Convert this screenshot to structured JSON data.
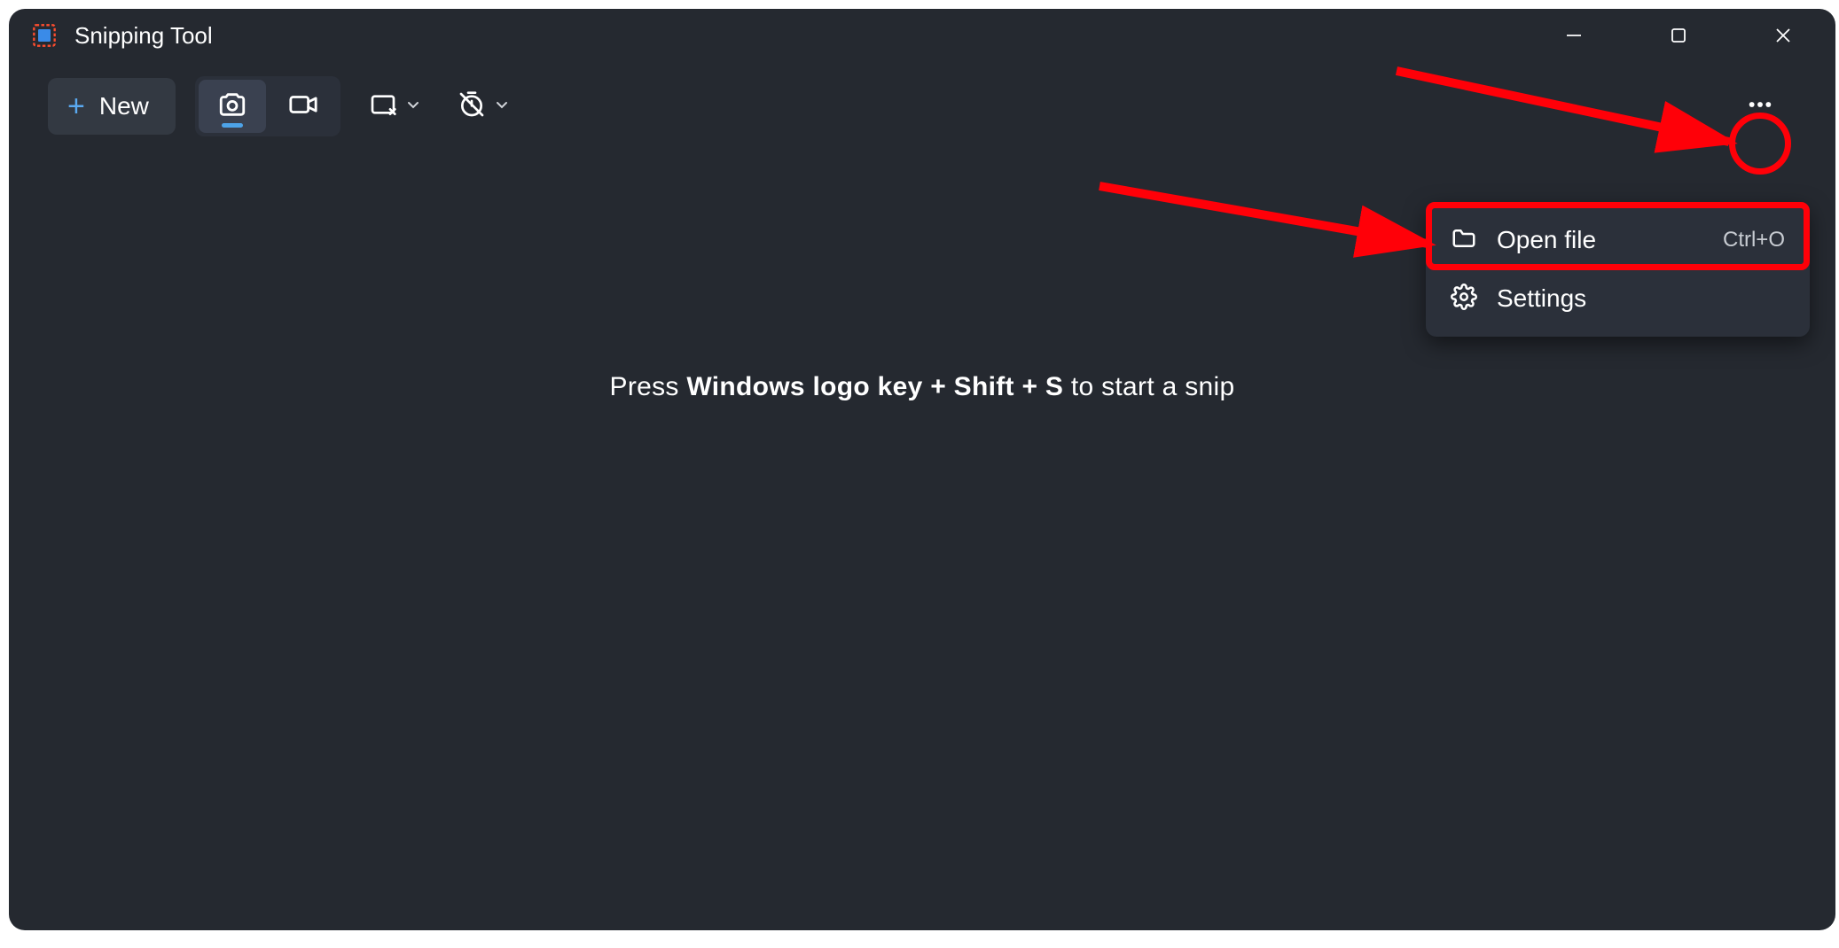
{
  "app": {
    "title": "Snipping Tool"
  },
  "toolbar": {
    "new_label": "New"
  },
  "menu": {
    "items": [
      {
        "label": "Open file",
        "shortcut": "Ctrl+O"
      },
      {
        "label": "Settings",
        "shortcut": ""
      }
    ]
  },
  "content": {
    "hint_pre": "Press ",
    "hint_bold": "Windows logo key + Shift + S",
    "hint_post": " to start a snip"
  }
}
